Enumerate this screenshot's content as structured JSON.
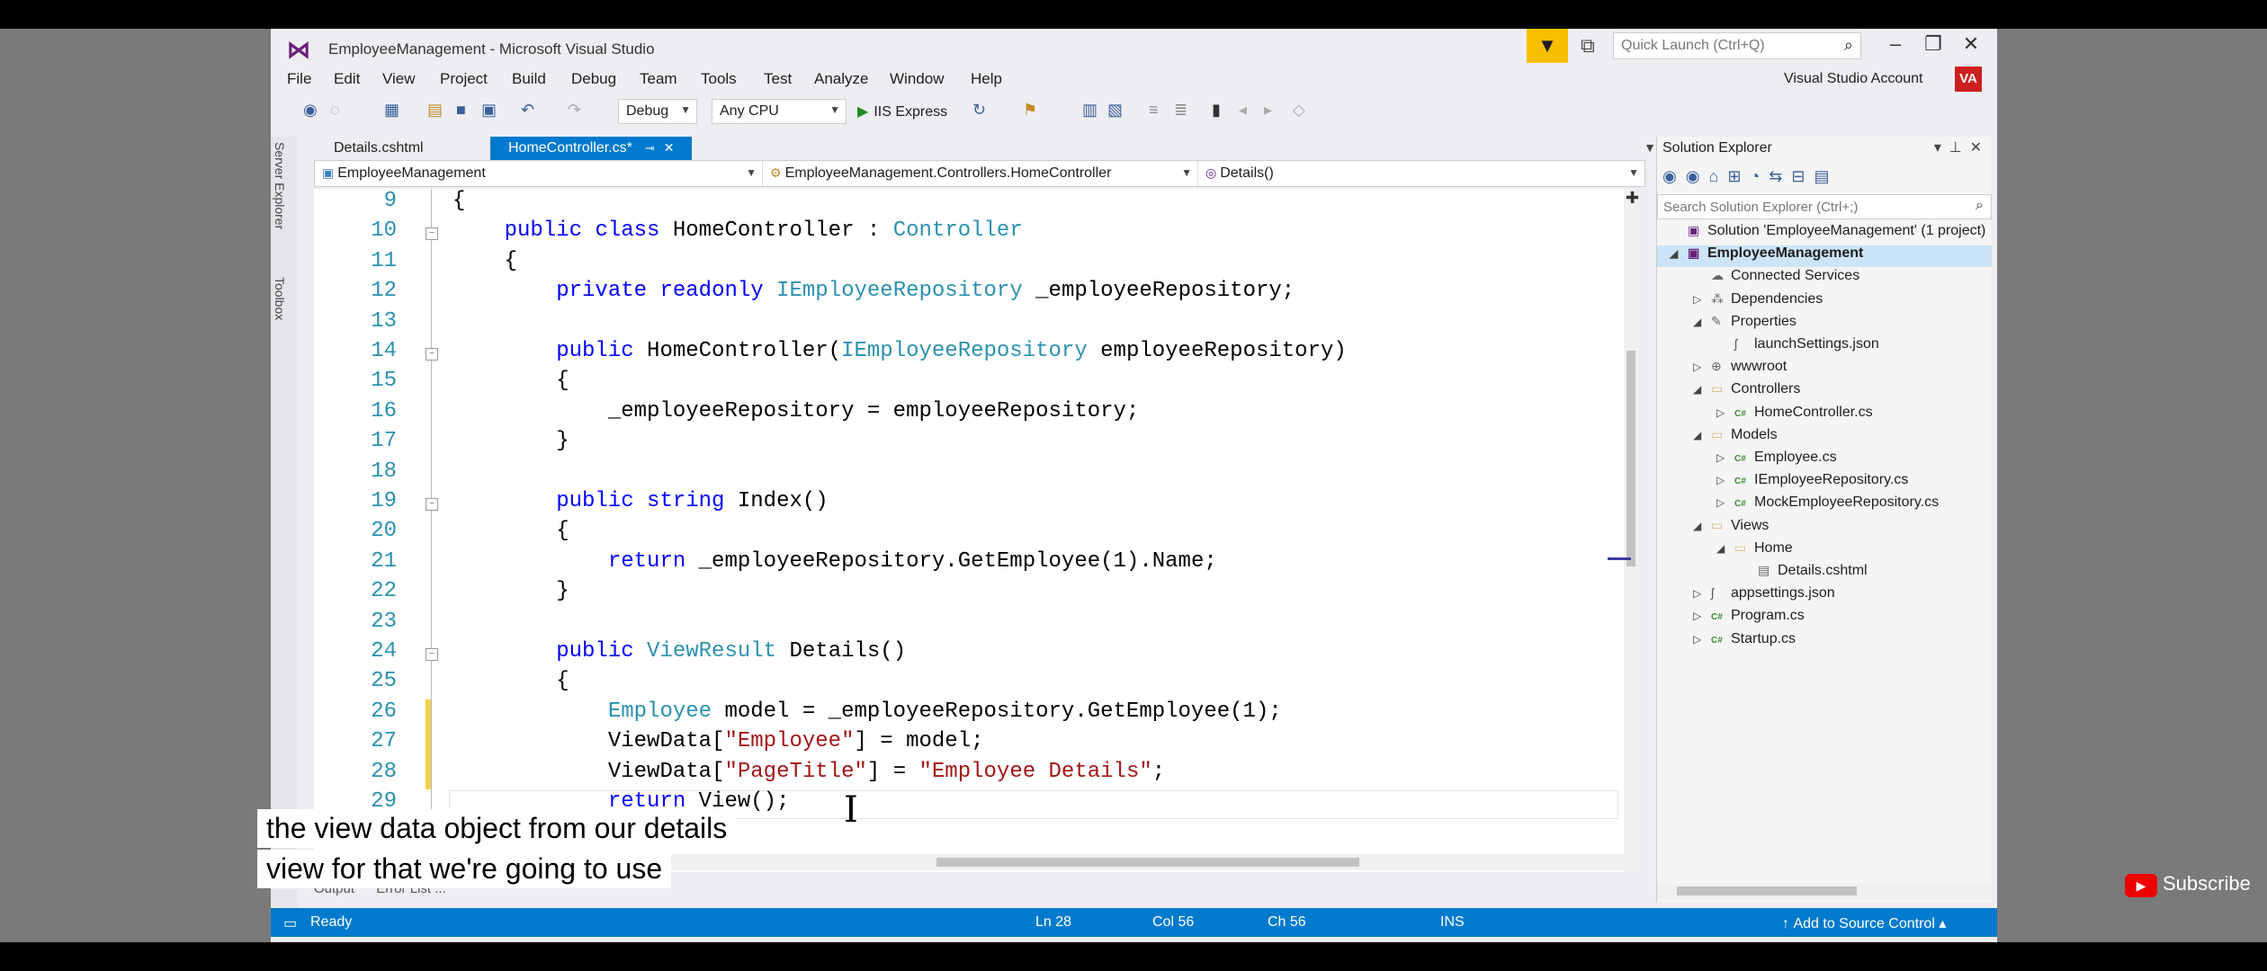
{
  "window": {
    "title": "EmployeeManagement - Microsoft Visual Studio",
    "quick_launch_placeholder": "Quick Launch (Ctrl+Q)",
    "account": "Visual Studio Account",
    "avatar_initials": "VA"
  },
  "menu": [
    "File",
    "Edit",
    "View",
    "Project",
    "Build",
    "Debug",
    "Team",
    "Tools",
    "Test",
    "Analyze",
    "Window",
    "Help"
  ],
  "toolbar": {
    "configuration": "Debug",
    "platform": "Any CPU",
    "run_target": "IIS Express"
  },
  "side_panels": [
    "Server Explorer",
    "Toolbox"
  ],
  "tabs": [
    {
      "label": "Details.cshtml",
      "active": false
    },
    {
      "label": "HomeController.cs*",
      "active": true
    }
  ],
  "navbar": {
    "project": "EmployeeManagement",
    "class": "EmployeeManagement.Controllers.HomeController",
    "member": "Details()"
  },
  "code": {
    "line_numbers": [
      "9",
      "10",
      "11",
      "12",
      "13",
      "14",
      "15",
      "16",
      "17",
      "18",
      "19",
      "20",
      "21",
      "22",
      "23",
      "24",
      "25",
      "26",
      "27",
      "28",
      "29"
    ],
    "lines": [
      "{",
      "    public class HomeController : Controller",
      "    {",
      "        private readonly IEmployeeRepository _employeeRepository;",
      "",
      "        public HomeController(IEmployeeRepository employeeRepository)",
      "        {",
      "            _employeeRepository = employeeRepository;",
      "        }",
      "",
      "        public string Index()",
      "        {",
      "            return _employeeRepository.GetEmployee(1).Name;",
      "        }",
      "",
      "        public ViewResult Details()",
      "        {",
      "            Employee model = _employeeRepository.GetEmployee(1);",
      "            ViewData[\"Employee\"] = model;",
      "            ViewData[\"PageTitle\"] = \"Employee Details\";",
      "            return View();"
    ]
  },
  "solution_explorer": {
    "title": "Solution Explorer",
    "search_placeholder": "Search Solution Explorer (Ctrl+;)",
    "items": [
      {
        "label": "Solution 'EmployeeManagement' (1 project)",
        "depth": 0,
        "icon": "solution-icon",
        "twisty": ""
      },
      {
        "label": "EmployeeManagement",
        "depth": 0,
        "icon": "project-icon",
        "twisty": "◢",
        "selected": true
      },
      {
        "label": "Connected Services",
        "depth": 1,
        "icon": "connected-services-icon",
        "twisty": ""
      },
      {
        "label": "Dependencies",
        "depth": 1,
        "icon": "dependencies-icon",
        "twisty": "▷"
      },
      {
        "label": "Properties",
        "depth": 1,
        "icon": "wrench-icon",
        "twisty": "◢"
      },
      {
        "label": "launchSettings.json",
        "depth": 2,
        "icon": "json-file-icon",
        "twisty": ""
      },
      {
        "label": "wwwroot",
        "depth": 1,
        "icon": "globe-icon",
        "twisty": "▷"
      },
      {
        "label": "Controllers",
        "depth": 1,
        "icon": "folder-icon",
        "twisty": "◢"
      },
      {
        "label": "HomeController.cs",
        "depth": 2,
        "icon": "csharp-file-icon",
        "twisty": "▷"
      },
      {
        "label": "Models",
        "depth": 1,
        "icon": "folder-icon",
        "twisty": "◢"
      },
      {
        "label": "Employee.cs",
        "depth": 2,
        "icon": "csharp-file-icon",
        "twisty": "▷"
      },
      {
        "label": "IEmployeeRepository.cs",
        "depth": 2,
        "icon": "csharp-file-icon",
        "twisty": "▷"
      },
      {
        "label": "MockEmployeeRepository.cs",
        "depth": 2,
        "icon": "csharp-file-icon",
        "twisty": "▷"
      },
      {
        "label": "Views",
        "depth": 1,
        "icon": "folder-icon",
        "twisty": "◢"
      },
      {
        "label": "Home",
        "depth": 2,
        "icon": "folder-icon",
        "twisty": "◢"
      },
      {
        "label": "Details.cshtml",
        "depth": 3,
        "icon": "cshtml-file-icon",
        "twisty": ""
      },
      {
        "label": "appsettings.json",
        "depth": 1,
        "icon": "json-file-icon",
        "twisty": "▷"
      },
      {
        "label": "Program.cs",
        "depth": 1,
        "icon": "csharp-file-icon",
        "twisty": "▷"
      },
      {
        "label": "Startup.cs",
        "depth": 1,
        "icon": "csharp-file-icon",
        "twisty": "▷"
      }
    ]
  },
  "bottom_tabs": [
    "Output",
    "Error List ..."
  ],
  "status": {
    "state": "Ready",
    "line": "Ln 28",
    "col": "Col 56",
    "ch": "Ch 56",
    "mode": "INS",
    "source_control": "Add to Source Control"
  },
  "caption": {
    "line1": "the view data object from our details",
    "line2": "view for that we're going to use"
  },
  "subscribe_label": "Subscribe",
  "colors": {
    "accent": "#007acc",
    "keyword": "#0000ff",
    "type": "#2b91af",
    "string": "#a31515",
    "filter_button": "#f6c000"
  }
}
